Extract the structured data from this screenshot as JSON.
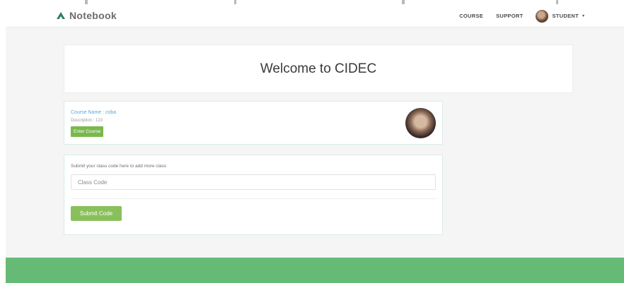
{
  "header": {
    "brand": "Notebook",
    "nav": [
      "COURSE",
      "SUPPORT"
    ],
    "user_label": "STUDENT",
    "user_caret": "▾"
  },
  "welcome": {
    "title": "Welcome to CIDEC"
  },
  "course": {
    "name": "Course Name : coba",
    "description": "Description : 123",
    "enter_label": "Enter Course"
  },
  "class_code": {
    "prompt": "Submit your class code here to add more class",
    "placeholder": "Class Code",
    "submit_label": "Submit Code"
  },
  "colors": {
    "accent_green": "#79b94c",
    "footer_green": "#65bb75",
    "link_blue": "#5aa9d8",
    "brand_teal": "#2f7d6c"
  },
  "icons": {
    "brand": "chevron-up-icon",
    "caret": "caret-down-icon",
    "avatar": "user-avatar",
    "course_photo": "course-photo"
  }
}
